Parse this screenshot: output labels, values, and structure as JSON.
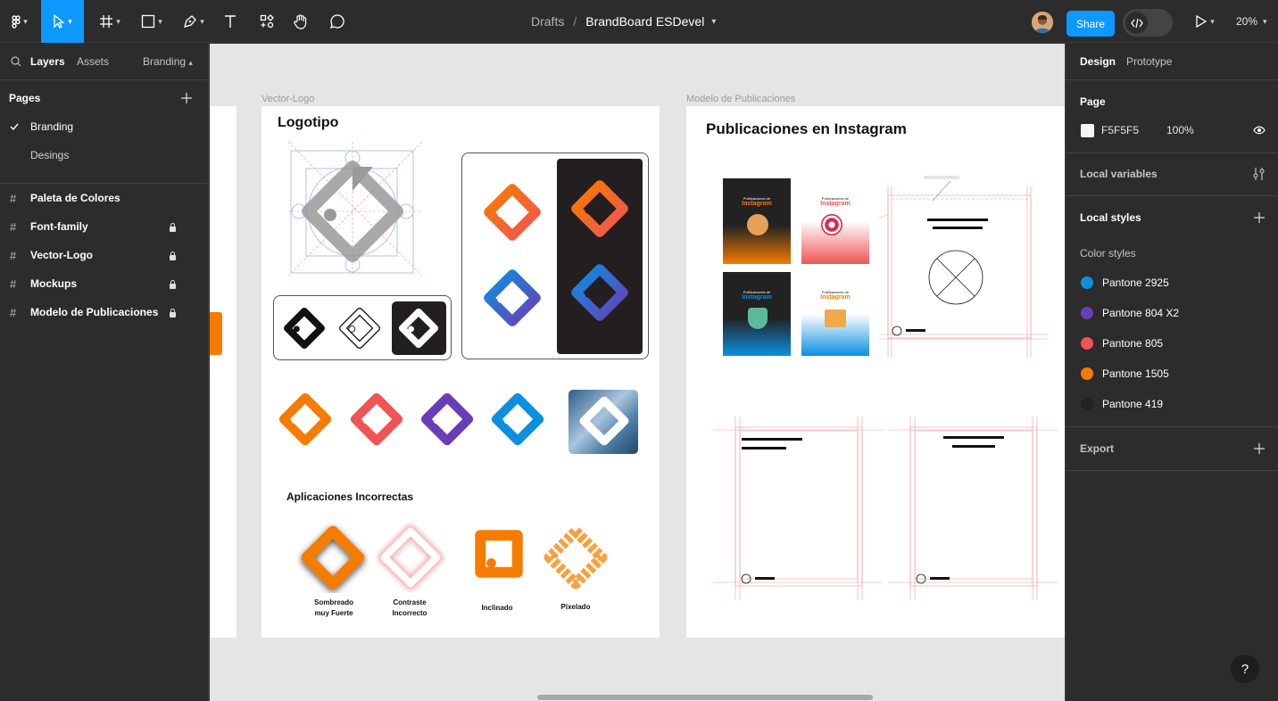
{
  "toolbar": {
    "breadcrumb_project": "Drafts",
    "breadcrumb_separator": "/",
    "file_name": "BrandBoard ESDevel",
    "share_label": "Share",
    "zoom_label": "20%"
  },
  "left_panel": {
    "tabs": {
      "layers": "Layers",
      "assets": "Assets",
      "page_switcher": "Branding"
    },
    "pages_header": "Pages",
    "pages": [
      {
        "label": "Branding",
        "selected": true
      },
      {
        "label": "Desings",
        "selected": false
      }
    ],
    "layers": [
      {
        "label": "Paleta de Colores",
        "locked": false
      },
      {
        "label": "Font-family",
        "locked": true
      },
      {
        "label": "Vector-Logo",
        "locked": true
      },
      {
        "label": "Mockups",
        "locked": true
      },
      {
        "label": "Modelo de Publicaciones",
        "locked": true
      }
    ]
  },
  "canvas": {
    "frames": [
      {
        "label": "Vector-Logo"
      },
      {
        "label": "Modelo de Publicaciones"
      }
    ],
    "logo_frame": {
      "title": "Logotipo",
      "incorrect_title": "Aplicaciones Incorrectas",
      "incorrect_items": [
        {
          "line1": "Sombreado",
          "line2": "muy Fuerte"
        },
        {
          "line1": "Contraste",
          "line2": "Incorrecto"
        },
        {
          "line1": "Inclinado",
          "line2": ""
        },
        {
          "line1": "Pixelado",
          "line2": ""
        }
      ]
    },
    "posts_frame": {
      "title": "Publicaciones en Instagram",
      "card_kicker": "Publicaciones de",
      "card_brand": "Instagram"
    }
  },
  "right_panel": {
    "tabs": {
      "design": "Design",
      "prototype": "Prototype"
    },
    "page_section": "Page",
    "page_color_hex": "F5F5F5",
    "page_opacity": "100%",
    "local_variables": "Local variables",
    "local_styles": "Local styles",
    "color_styles_header": "Color styles",
    "color_styles": [
      {
        "name": "Pantone 2925",
        "color": "#0d8fe0"
      },
      {
        "name": "Pantone 804 X2",
        "color": "#6a3db8"
      },
      {
        "name": "Pantone 805",
        "color": "#f05454"
      },
      {
        "name": "Pantone 1505",
        "color": "#f57c00"
      },
      {
        "name": "Pantone 419",
        "color": "#1f2520"
      }
    ],
    "export_label": "Export"
  },
  "help_label": "?"
}
